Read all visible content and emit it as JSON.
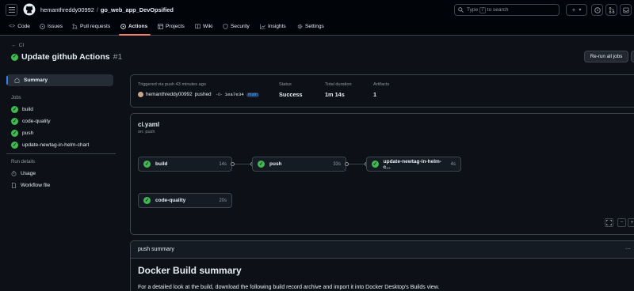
{
  "header": {
    "owner": "hemanthreddy00992",
    "separator": "/",
    "repo": "go_web_app_DevOpsified",
    "search_prefix": "Type",
    "search_key": "/",
    "search_suffix": "to search",
    "plus": "+",
    "caret": "▾"
  },
  "nav": {
    "items": [
      {
        "label": "Code"
      },
      {
        "label": "Issues"
      },
      {
        "label": "Pull requests"
      },
      {
        "label": "Actions"
      },
      {
        "label": "Projects"
      },
      {
        "label": "Wiki"
      },
      {
        "label": "Security"
      },
      {
        "label": "Insights"
      },
      {
        "label": "Settings"
      }
    ],
    "active_color": "#f78166"
  },
  "run": {
    "back_label": "CI",
    "title": "Update github Actions",
    "number": "#1",
    "rerun_label": "Re-run all jobs"
  },
  "sidebar": {
    "summary_label": "Summary",
    "jobs_heading": "Jobs",
    "jobs": [
      {
        "label": "build"
      },
      {
        "label": "code-quality"
      },
      {
        "label": "push"
      },
      {
        "label": "update-newtag-in-helm-chart"
      }
    ],
    "run_details_heading": "Run details",
    "details": [
      {
        "label": "Usage"
      },
      {
        "label": "Workflow file"
      }
    ]
  },
  "summary": {
    "trigger_label": "Triggered via push 43 minutes ago",
    "actor": "hemanthreddy00992",
    "action": "pushed",
    "commit": "1ea7e34",
    "branch": "main",
    "status_label": "Status",
    "status_value": "Success",
    "duration_label": "Total duration",
    "duration_value": "1m 14s",
    "artifacts_label": "Artifacts",
    "artifacts_value": "1"
  },
  "workflow": {
    "file": "ci.yaml",
    "trigger": "on: push",
    "jobs": [
      {
        "name": "build",
        "duration": "14s"
      },
      {
        "name": "push",
        "duration": "33s"
      },
      {
        "name": "update-newtag-in-helm-c...",
        "duration": "4s"
      },
      {
        "name": "code-quality",
        "duration": "20s"
      }
    ],
    "zoom_out": "−",
    "zoom_in": "+"
  },
  "push_summary": {
    "header": "push summary",
    "title": "Docker Build summary",
    "text": "For a detailed look at the build, download the following build record archive and import it into Docker Desktop's Builds view."
  },
  "colors": {
    "success": "#3fb950",
    "accent": "#2f81f7",
    "background": "#0d1117",
    "border": "#3d444d"
  }
}
